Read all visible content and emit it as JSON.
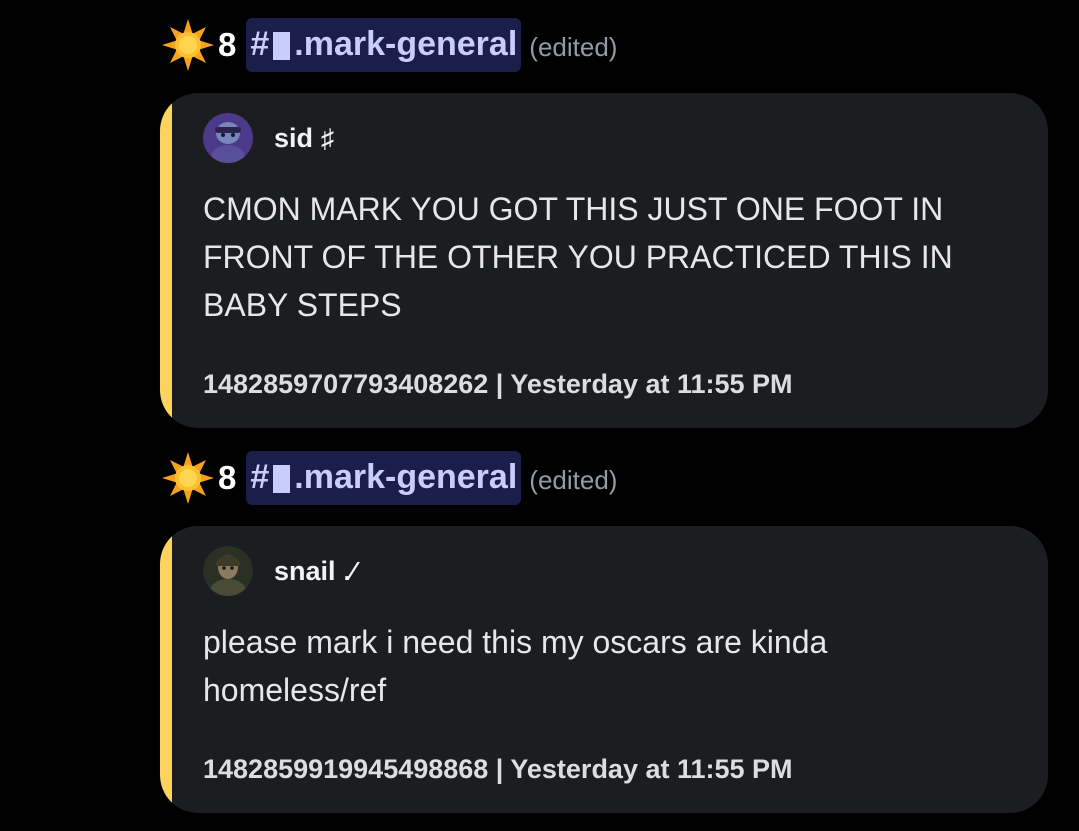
{
  "colors": {
    "background": "#000000",
    "embed_background": "#1c1d21",
    "embed_accent": "#fcd35c",
    "channel_mention_bg": "#3c4270",
    "channel_mention_text": "#c9cdfb"
  },
  "messages": [
    {
      "icon": "star-icon",
      "count": "8",
      "channel": {
        "hash": "#",
        "name": ".mark-general"
      },
      "edited": "(edited)",
      "embed": {
        "author": {
          "name": "sid",
          "tag": "♯"
        },
        "text": "CMON MARK YOU GOT THIS JUST ONE FOOT IN FRONT OF THE OTHER YOU PRACTICED THIS IN BABY STEPS",
        "footer": "1482859707793408262 | Yesterday at 11:55 PM"
      }
    },
    {
      "icon": "star-icon",
      "count": "8",
      "channel": {
        "hash": "#",
        "name": ".mark-general"
      },
      "edited": "(edited)",
      "embed": {
        "author": {
          "name": "snail",
          "tag": ".⁄"
        },
        "text": "please mark i need this my oscars are kinda homeless/ref",
        "footer": "1482859919945498868 | Yesterday at 11:55 PM"
      }
    }
  ]
}
